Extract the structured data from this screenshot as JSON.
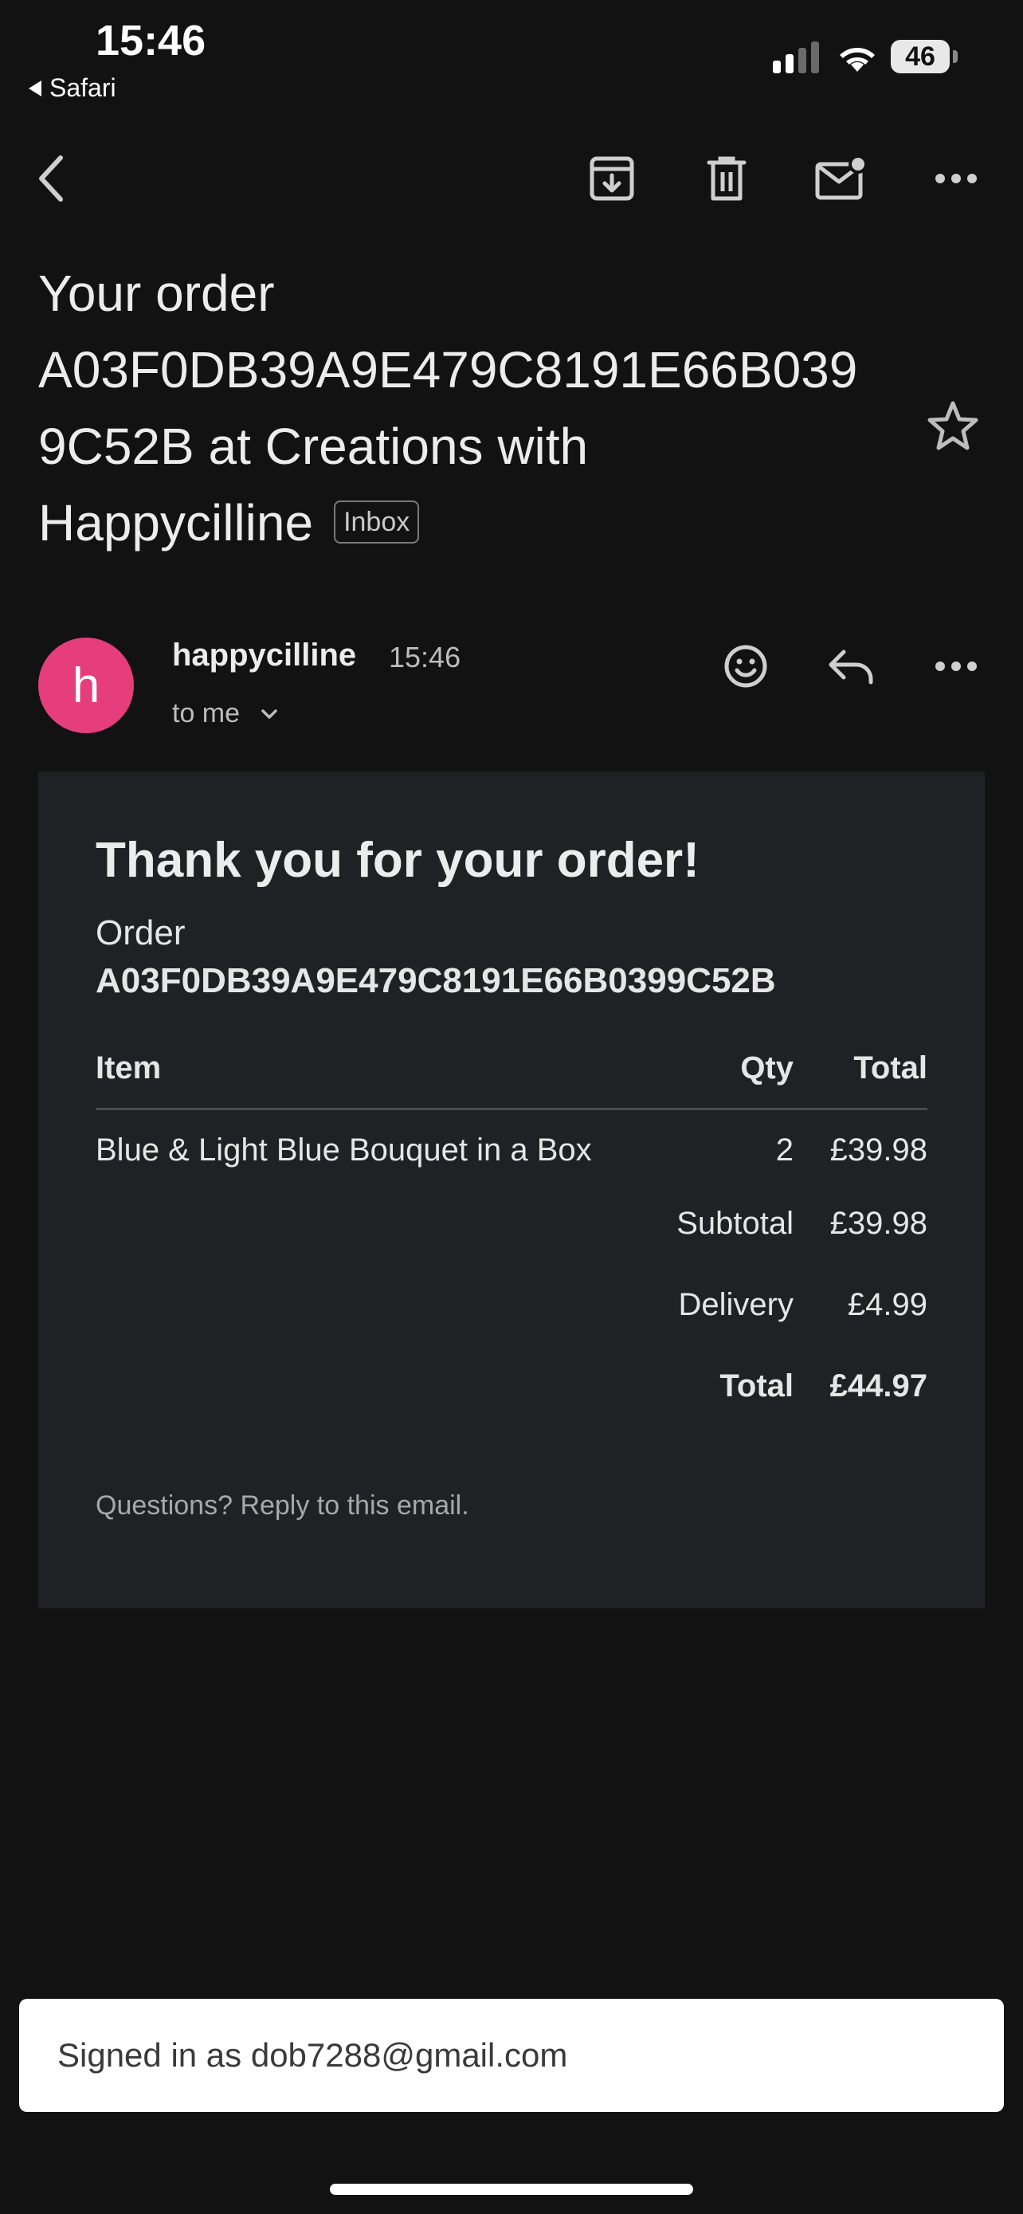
{
  "status_bar": {
    "time": "15:46",
    "back_app": "Safari",
    "battery": "46"
  },
  "toolbar": {
    "back_icon": "chevron-left-icon",
    "archive_icon": "archive-icon",
    "delete_icon": "trash-icon",
    "mark_unread_icon": "mail-unread-icon",
    "more_icon": "more-horizontal-icon"
  },
  "email": {
    "subject_lines": [
      "Your order",
      "A03F0DB39A9E479C8191E66B039",
      "9C52B at Creations with",
      "Happycilline"
    ],
    "label": "Inbox",
    "sender": {
      "avatar_letter": "h",
      "avatar_color": "#e63d7d",
      "name": "happycilline",
      "time": "15:46",
      "recipient": "to me"
    },
    "body": {
      "heading": "Thank you for your order!",
      "order_label": "Order",
      "order_number": "A03F0DB39A9E479C8191E66B0399C52B",
      "table": {
        "headers": {
          "item": "Item",
          "qty": "Qty",
          "total": "Total"
        },
        "rows": [
          {
            "item": "Blue & Light Blue Bouquet in a Box",
            "qty": "2",
            "total": "£39.98"
          }
        ]
      },
      "summary": {
        "subtotal_label": "Subtotal",
        "subtotal": "£39.98",
        "delivery_label": "Delivery",
        "delivery": "£4.99",
        "total_label": "Total",
        "total": "£44.97"
      },
      "footer": "Questions? Reply to this email."
    }
  },
  "account_banner": {
    "text": "Signed in as dob7288@gmail.com"
  }
}
